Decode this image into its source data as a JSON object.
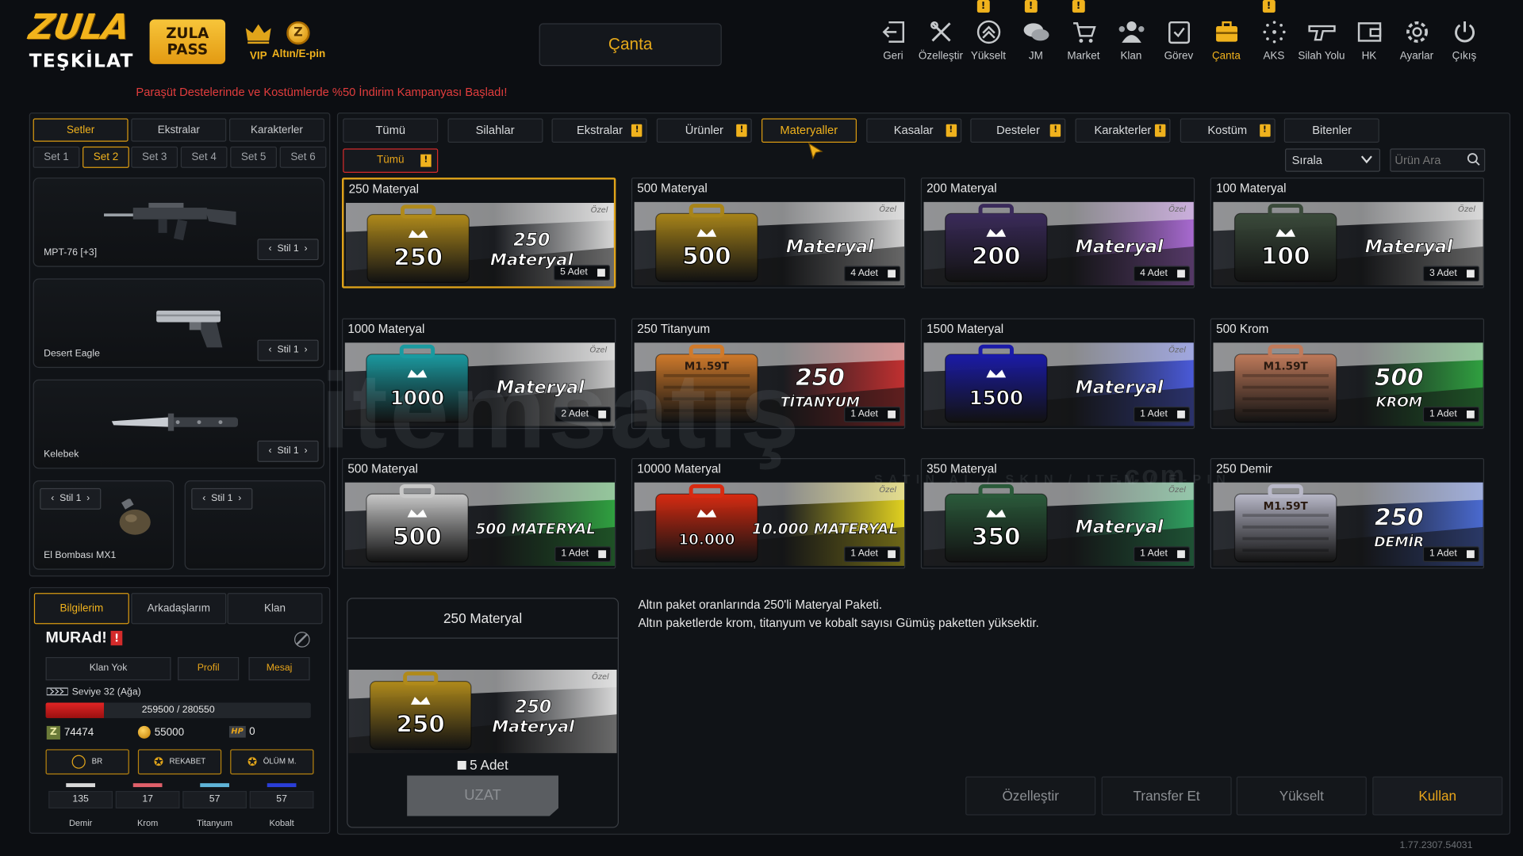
{
  "app": {
    "logo_top": "ZULA",
    "logo_bottom": "TEŞKİLAT",
    "pass_line1": "ZULA",
    "pass_line2": "PASS",
    "vip_label": "VIP",
    "altin_label": "Altın/E-pin",
    "page_title": "Çanta",
    "announcement": "Paraşüt Destelerinde ve Kostümlerde %50 İndirim Kampanyası Başladı!",
    "version": "1.77.2307.54031"
  },
  "nav": [
    {
      "label": "Geri",
      "icon": "back-icon"
    },
    {
      "label": "Özelleştir",
      "icon": "tools-icon"
    },
    {
      "label": "Yükselt",
      "icon": "upgrade-icon",
      "badge": "!"
    },
    {
      "label": "JM",
      "icon": "chat-icon",
      "badge": "!"
    },
    {
      "label": "Market",
      "icon": "cart-icon",
      "badge": "!"
    },
    {
      "label": "Klan",
      "icon": "clan-icon"
    },
    {
      "label": "Görev",
      "icon": "task-icon"
    },
    {
      "label": "Çanta",
      "icon": "bag-icon",
      "active": true
    },
    {
      "label": "AKS",
      "icon": "aks-icon",
      "badge": "!"
    },
    {
      "label": "Silah Yolu",
      "icon": "gun-icon"
    },
    {
      "label": "HK",
      "icon": "wallet-icon"
    },
    {
      "label": "Ayarlar",
      "icon": "gear-icon"
    },
    {
      "label": "Çıkış",
      "icon": "power-icon"
    }
  ],
  "left": {
    "tabs": [
      "Setler",
      "Ekstralar",
      "Karakterler"
    ],
    "sets": [
      "Set 1",
      "Set 2",
      "Set 3",
      "Set 4",
      "Set 5",
      "Set 6"
    ],
    "active_set": "Set 2",
    "slots": [
      {
        "name": "MPT-76 [+3]",
        "style": "Stil 1"
      },
      {
        "name": "Desert Eagle",
        "style": "Stil 1"
      },
      {
        "name": "Kelebek",
        "style": "Stil 1"
      },
      {
        "name": "El Bombası MX1",
        "style": "Stil 1"
      },
      {
        "name": "",
        "style": "Stil 1"
      }
    ]
  },
  "profile": {
    "tabs": [
      "Bilgilerim",
      "Arkadaşlarım",
      "Klan"
    ],
    "username": "MURAd!",
    "warn": "!",
    "clan_btn": "Klan Yok",
    "profile_btn": "Profil",
    "message_btn": "Mesaj",
    "level": "Seviye 32 (Ağa)",
    "xp_text": "259500 / 280550",
    "xp_fraction": 0.22,
    "zula_points": "74474",
    "gold": "55000",
    "hp": "0",
    "hp_label": "HP",
    "modes": [
      "BR",
      "REKABET",
      "ÖLÜM M."
    ],
    "materials": [
      {
        "name": "Demir",
        "value": "135",
        "color": "#d9d9d9"
      },
      {
        "name": "Krom",
        "value": "17",
        "color": "#e0606a"
      },
      {
        "name": "Titanyum",
        "value": "57",
        "color": "#5fb4d8"
      },
      {
        "name": "Kobalt",
        "value": "57",
        "color": "#2a3ed8"
      }
    ]
  },
  "categories": [
    {
      "label": "Tümü"
    },
    {
      "label": "Silahlar"
    },
    {
      "label": "Ekstralar",
      "badge": "!"
    },
    {
      "label": "Ürünler",
      "badge": "!"
    },
    {
      "label": "Materyaller",
      "active": true
    },
    {
      "label": "Kasalar",
      "badge": "!"
    },
    {
      "label": "Desteler",
      "badge": "!"
    },
    {
      "label": "Karakterler",
      "badge": "!"
    },
    {
      "label": "Kostüm",
      "badge": "!"
    },
    {
      "label": "Bitenler"
    }
  ],
  "subfilter": {
    "label": "Tümü",
    "badge": "!"
  },
  "sort_label": "Sırala",
  "search_placeholder": "Ürün Ara",
  "items": [
    {
      "title": "250 Materyal",
      "case_num": "250",
      "text1": "250",
      "text2": "Materyal",
      "count": "5 Adet",
      "tag": "Özel",
      "color": "#b08a1a",
      "bg": "#d8d8d8",
      "selected": true
    },
    {
      "title": "500 Materyal",
      "case_num": "500",
      "text1": "",
      "text2": "Materyal",
      "count": "4 Adet",
      "tag": "Özel",
      "color": "#a88418",
      "bg": "#d0d0d0"
    },
    {
      "title": "200 Materyal",
      "case_num": "200",
      "text1": "",
      "text2": "Materyal",
      "count": "4 Adet",
      "tag": "Özel",
      "color": "#3a2a5a",
      "bg": "#a86ad0"
    },
    {
      "title": "100 Materyal",
      "case_num": "100",
      "text1": "",
      "text2": "Materyal",
      "count": "3 Adet",
      "tag": "Özel",
      "color": "#3a4a3a",
      "bg": "#c8c8c8"
    },
    {
      "title": "1000 Materyal",
      "case_num": "1000",
      "text1": "",
      "text2": "Materyal",
      "count": "2 Adet",
      "tag": "Özel",
      "color": "#1a9aa0",
      "bg": "#c8c8c8"
    },
    {
      "title": "250 Titanyum",
      "case_num": "M1.59T",
      "text1": "250",
      "text2": "TİTANYUM",
      "count": "1 Adet",
      "tag": "",
      "color": "#d07a2a",
      "bg": "#c03030"
    },
    {
      "title": "1500 Materyal",
      "case_num": "1500",
      "text1": "",
      "text2": "Materyal",
      "count": "1 Adet",
      "tag": "Özel",
      "color": "#1a1aa8",
      "bg": "#4a5ad8"
    },
    {
      "title": "500 Krom",
      "case_num": "M1.59T",
      "text1": "500",
      "text2": "KROM",
      "count": "1 Adet",
      "tag": "",
      "color": "#c07a5a",
      "bg": "#30a040"
    },
    {
      "title": "500 Materyal",
      "case_num": "500",
      "text1": "500 MATERYAL",
      "text2": "",
      "count": "1 Adet",
      "tag": "",
      "color": "#c8c8c8",
      "bg": "#30a040"
    },
    {
      "title": "10000 Materyal",
      "case_num": "10.000",
      "text1": "10.000 MATERYAL",
      "text2": "",
      "count": "1 Adet",
      "tag": "Özel",
      "color": "#d82a10",
      "bg": "#e0d020"
    },
    {
      "title": "350 Materyal",
      "case_num": "350",
      "text1": "",
      "text2": "Materyal",
      "count": "1 Adet",
      "tag": "Özel",
      "color": "#2a5a3a",
      "bg": "#30a060"
    },
    {
      "title": "250 Demir",
      "case_num": "M1.59T",
      "text1": "250",
      "text2": "DEMİR",
      "count": "1 Adet",
      "tag": "",
      "color": "#b8b8c8",
      "bg": "#4a6ad0"
    }
  ],
  "detail": {
    "title": "250 Materyal",
    "case_num": "250",
    "text1": "250",
    "text2": "Materyal",
    "tag": "Özel",
    "count": "5 Adet",
    "extend_btn": "UZAT",
    "desc_line1": "Altın paket oranlarında 250'li Materyal Paketi.",
    "desc_line2": "Altın paketlerde krom, titanyum ve kobalt sayısı Gümüş paketten yüksektir."
  },
  "actions": [
    "Özelleştir",
    "Transfer Et",
    "Yükselt",
    "Kullan"
  ],
  "watermark": {
    "main": "itemsatış",
    "sub": "SATIN AL / SKIN / ITEM / E-PIN",
    "dom": ".com"
  }
}
